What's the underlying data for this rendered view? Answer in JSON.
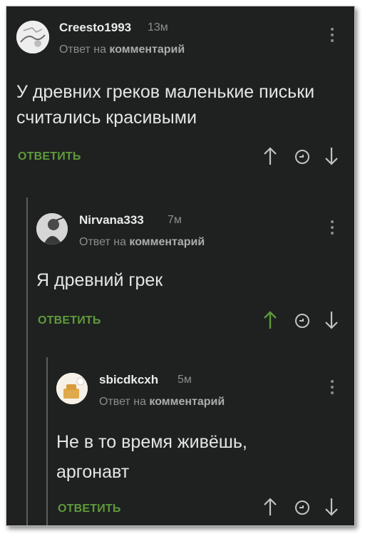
{
  "comments": [
    {
      "username": "Creesto1993",
      "time": "13м",
      "reply_prefix": "Ответ на",
      "reply_target": "комментарий",
      "text": "У древних греков маленькие письки считались красивыми",
      "reply_button": "ОТВЕТИТЬ",
      "upvote_active": false
    },
    {
      "username": "Nirvana333",
      "time": "7м",
      "reply_prefix": "Ответ на",
      "reply_target": "комментарий",
      "text": "Я древний грек",
      "reply_button": "ОТВЕТИТЬ",
      "upvote_active": true
    },
    {
      "username": "sbicdkcxh",
      "time": "5м",
      "reply_prefix": "Ответ на",
      "reply_target": "комментарий",
      "text": "Не в то время живёшь, аргонавт",
      "reply_button": "ОТВЕТИТЬ",
      "upvote_active": false
    }
  ],
  "icons": {
    "upvote": "arrow-up-icon",
    "save": "clock-icon",
    "downvote": "arrow-down-icon",
    "menu": "kebab-menu-icon"
  },
  "colors": {
    "background": "#1e2120",
    "accent_green": "#5f9a3a",
    "text_primary": "#e3e6e4",
    "text_muted": "#8a8e8c"
  }
}
